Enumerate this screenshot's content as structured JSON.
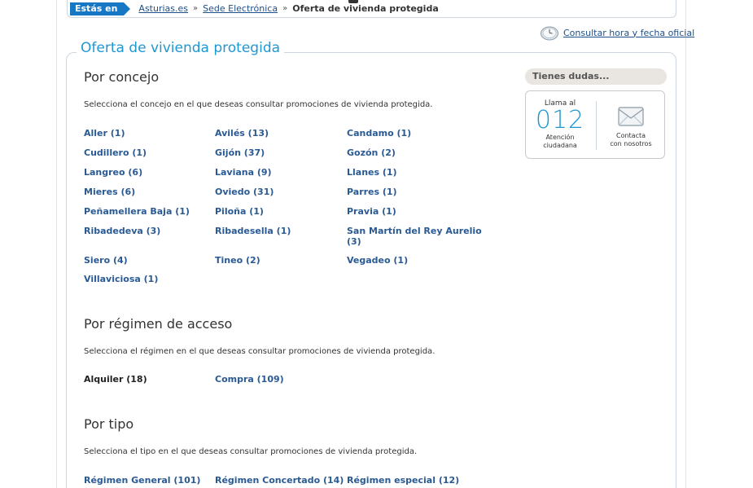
{
  "breadcrumb": {
    "tag": "Estás en",
    "items": [
      "Asturias.es",
      "Sede Electrónica"
    ],
    "separator": "»",
    "current": "Oferta de vivienda protegida"
  },
  "clock": {
    "icon": "clock-icon",
    "label": "Consultar hora y fecha oficial"
  },
  "page_title": "Oferta de vivienda protegida",
  "sections": {
    "concejo": {
      "title": "Por concejo",
      "desc": "Selecciona el concejo en el que deseas consultar promociones de vivienda protegida.",
      "items": [
        "Aller (1)",
        "Avilés (13)",
        "Candamo (1)",
        "Cudillero (1)",
        "Gijón (37)",
        "Gozón (2)",
        "Langreo (6)",
        "Laviana (9)",
        "Llanes (1)",
        "Mieres (6)",
        "Oviedo (31)",
        "Parres (1)",
        "Peñamellera Baja (1)",
        "Piloña (1)",
        "Pravia (1)",
        "Ribadedeva (3)",
        "Ribadesella (1)",
        "San Martín del Rey Aurelio",
        "(3)",
        "Siero (4)",
        "Tineo (2)",
        "Vegadeo (1)",
        "Villaviciosa (1)"
      ]
    },
    "regimen": {
      "title": "Por régimen de acceso",
      "desc": "Selecciona el régimen en el que deseas consultar promociones de vivienda protegida.",
      "items": [
        "Alquiler (18)",
        "Compra (109)"
      ]
    },
    "tipo": {
      "title": "Por tipo",
      "desc": "Selecciona el tipo en el que deseas consultar promociones de vivienda protegida.",
      "items": [
        "Régimen General (101)",
        "Régimen Concertado (14)",
        "Régimen especial (12)"
      ]
    }
  },
  "sidebar": {
    "dudas": "Tienes dudas...",
    "phone": {
      "top": "Llama al",
      "number": "012",
      "sub1": "Atención",
      "sub2": "ciudadana"
    },
    "mail": {
      "icon": "envelope-icon",
      "sub1": "Contacta",
      "sub2": "con nosotros"
    }
  },
  "colors": {
    "accent": "#1f97d1",
    "link": "#2a5a94",
    "tag": "#1677c5"
  }
}
